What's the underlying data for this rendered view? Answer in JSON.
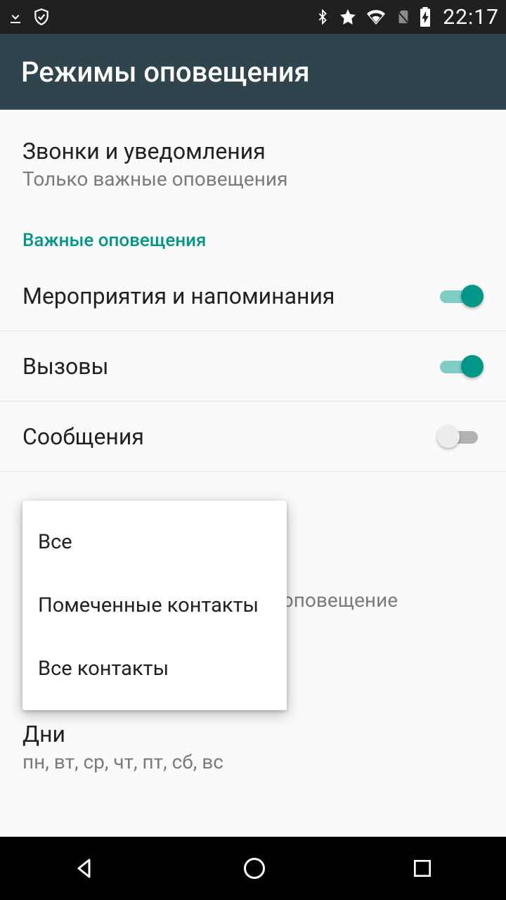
{
  "status": {
    "clock": "22:17"
  },
  "appbar": {
    "title": "Режимы оповещения"
  },
  "list": {
    "row0": {
      "title": "Звонки и уведомления",
      "sub": "Только важные оповещения"
    },
    "section1": "Важные оповещения",
    "row1": {
      "title": "Мероприятия и напоминания",
      "on": true
    },
    "row2": {
      "title": "Вызовы",
      "on": true
    },
    "row3": {
      "title": "Сообщения",
      "on": false
    },
    "row_days": {
      "title": "Дни",
      "sub": "пн, вт, ср, чт, пт, сб, вс"
    },
    "partial_behind": "е оповещение"
  },
  "popup": {
    "items": [
      "Все",
      "Помеченные контакты",
      "Все контакты"
    ]
  }
}
